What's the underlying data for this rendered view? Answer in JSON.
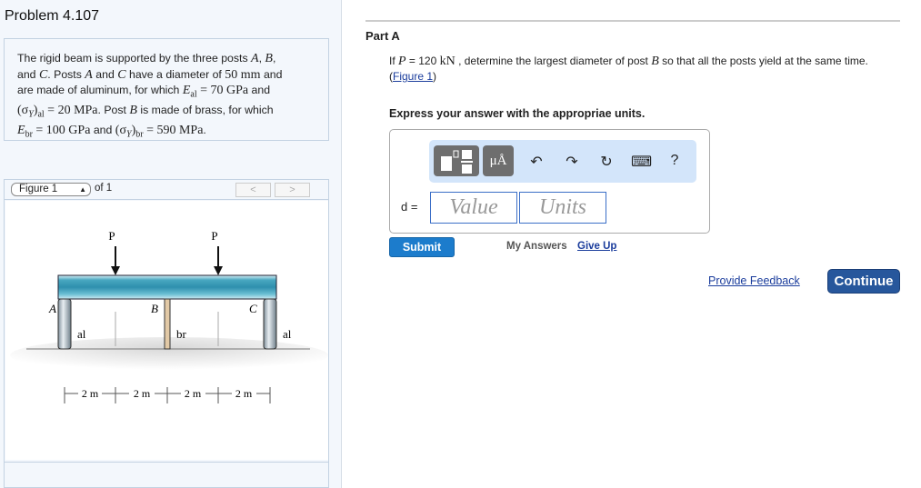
{
  "problem_title": "Problem 4.107",
  "problem_text": {
    "t1": "The rigid beam is supported by the three posts ",
    "A": "A",
    "c1": ", ",
    "B": "B",
    "c2": ",",
    "t2": "and ",
    "C": "C",
    "t3": ". Posts ",
    "t4": " and ",
    "t5": " have a diameter of ",
    "d50": "50 mm",
    "t6": " and",
    "t7": "are made of aluminum, for which ",
    "Eal": "E",
    "Eal_sub": "al",
    "Eal_val": " = 70 GPa",
    "t8": " and",
    "sal": "(σ",
    "sal_Y": "Y",
    "sal_close": ")",
    "sal_sub": "al",
    "sal_val": " = 20 MPa",
    "t9": ". Post ",
    "t10": " is made of brass, for which",
    "Ebr": "E",
    "Ebr_sub": "br",
    "Ebr_val": " = 100 GPa",
    "t11": " and ",
    "sbr_sub": "br",
    "sbr_val": " = 590 MPa",
    "t12": "."
  },
  "figure_nav": {
    "select": "Figure 1",
    "of": "of 1",
    "prev": "<",
    "next": ">"
  },
  "figure": {
    "P1": "P",
    "P2": "P",
    "A": "A",
    "B": "B",
    "C": "C",
    "al1": "al",
    "br": "br",
    "al2": "al",
    "d1": "2 m",
    "d2": "2 m",
    "d3": "2 m",
    "d4": "2 m"
  },
  "part": {
    "title": "Part A",
    "q1": "If ",
    "P": "P",
    "q2": " = 120 ",
    "kN": "kN",
    "q3": " , determine the largest diameter of post ",
    "B": "B",
    "q4": " so that all the posts yield at the same time.",
    "fig_open": "(",
    "fig_link": "Figure 1",
    "fig_close": ")",
    "express": "Express your answer with the appropriae units."
  },
  "toolbar": {
    "units_btn": "μÅ",
    "undo": "↶",
    "redo": "↷",
    "reset": "↻",
    "keyboard": "⌨",
    "help": "?"
  },
  "answer": {
    "label": "d =",
    "value_placeholder": "Value",
    "units_placeholder": "Units"
  },
  "actions": {
    "submit": "Submit",
    "my_answers": "My Answers",
    "give_up": "Give Up",
    "feedback": "Provide Feedback",
    "continue": "Continue"
  }
}
